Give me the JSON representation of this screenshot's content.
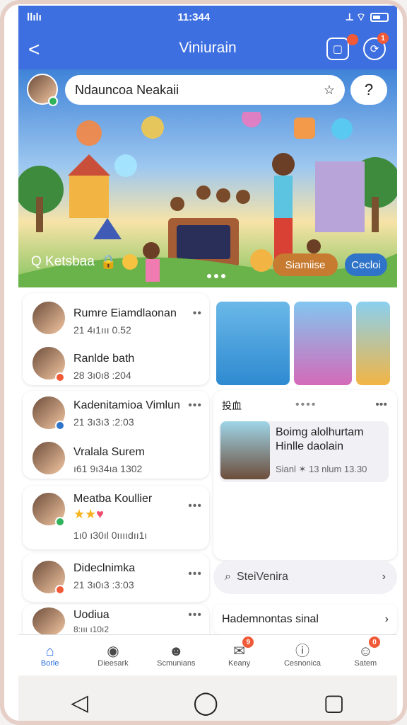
{
  "status": {
    "carrier": "llılı",
    "time": "11:344",
    "right": "⟂ ⌔"
  },
  "header": {
    "title": "Viniurain",
    "back": "<"
  },
  "banner": {
    "search_text": "Ndauncoa Neakaii",
    "overlay_left": "Q Ketsbaa",
    "pill_1": "Siamiise",
    "pill_2": "Cecloi"
  },
  "left_list": [
    {
      "name": "Rumre Eiamdlaonan",
      "meta": "21 4ı1ııı 0.52"
    },
    {
      "name": "Ranlde bath",
      "meta": "28 3ı0ı8 :204"
    },
    {
      "name": "Kadenitamioa Vimlun",
      "meta": "21 3ı3ı3 :2:03"
    },
    {
      "name": "Vralala Surem",
      "meta": "ı61 9ı34ıa 1302"
    },
    {
      "name": "Meatba Koullier",
      "meta": "1ı0 ı30ıl 0ııııdıı1ı"
    },
    {
      "name": "Dideclnimka",
      "meta": "21 3ı0ı3 :3:03"
    },
    {
      "name": "Uodiua",
      "meta": "8:ııı ı10ı2"
    }
  ],
  "right_panel": {
    "header_label": "投血",
    "featured_title": "Boimg alolhurtam Hinlle daolain",
    "featured_meta": "Sianl ✶ 13 nlum 13.30",
    "search_text": "SteiVenira",
    "bottom_link": "Hademnontas sinal"
  },
  "tabs": [
    {
      "label": "Borle",
      "icon": "home-icon"
    },
    {
      "label": "Dieesark",
      "icon": "discover-icon"
    },
    {
      "label": "Scmunians",
      "icon": "community-icon"
    },
    {
      "label": "Keany",
      "icon": "chat-icon"
    },
    {
      "label": "Cesnonica",
      "icon": "info-icon"
    },
    {
      "label": "Satem",
      "icon": "profile-icon"
    }
  ],
  "nav": {
    "back": "◁",
    "home": "◯",
    "recents": "▢"
  },
  "colors": {
    "brand": "#3e6fe0",
    "accent": "#f05a38"
  }
}
